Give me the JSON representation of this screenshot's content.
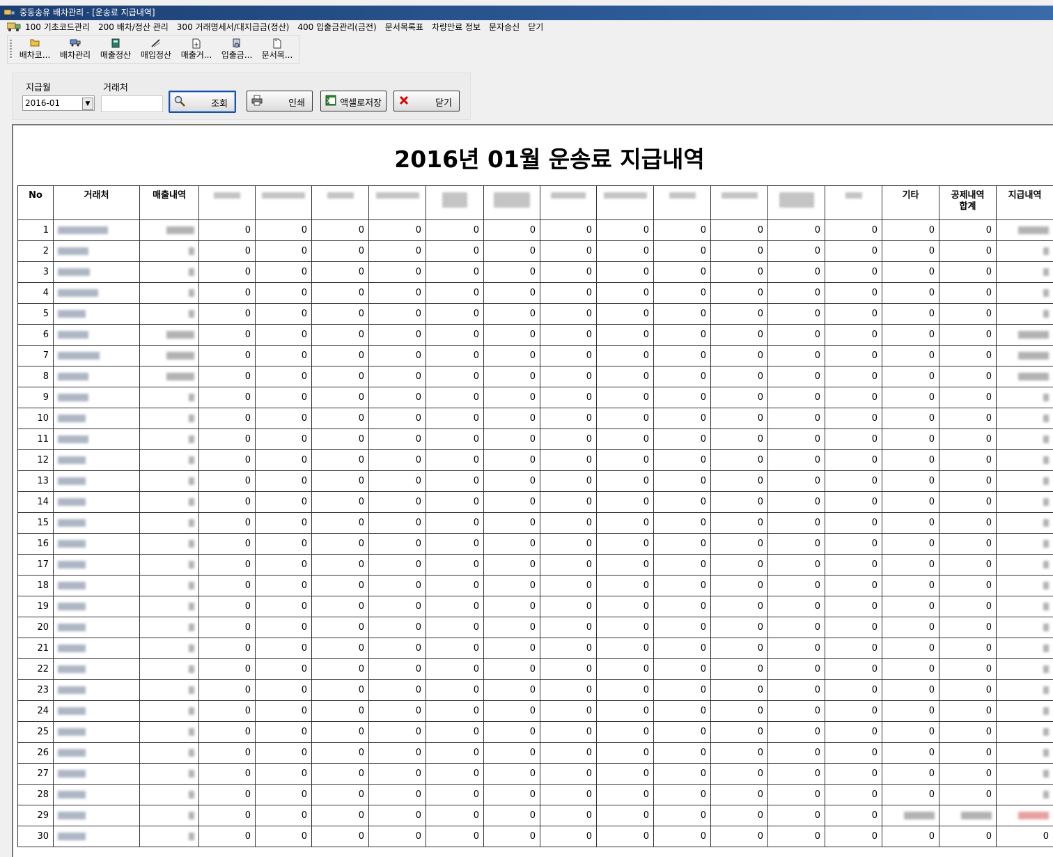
{
  "window": {
    "title": "중동송유 배차관리 - [운송료 지급내역]"
  },
  "menu": [
    "100 기초코드관리",
    "200 배차/정산 관리",
    "300 거래명세서/대지급금(정산)",
    "400 입출금관리(금전)",
    "문서목록표",
    "차량만료 정보",
    "문자송신",
    "닫기"
  ],
  "toolbar": [
    {
      "label": "배차코...",
      "icon": "folder-icon"
    },
    {
      "label": "배차관리",
      "icon": "truck-icon"
    },
    {
      "label": "매출정산",
      "icon": "calculator-icon"
    },
    {
      "label": "매입정산",
      "icon": "pencil-icon"
    },
    {
      "label": "매출거...",
      "icon": "document-add-icon"
    },
    {
      "label": "입출금...",
      "icon": "cash-icon"
    },
    {
      "label": "문서목...",
      "icon": "document-icon"
    }
  ],
  "filter": {
    "month_label": "지급월",
    "month_value": "2016-01",
    "partner_label": "거래처",
    "partner_value": "",
    "search_label": "조회",
    "print_label": "인쇄",
    "excel_label": "액셀로저장",
    "close_label": "닫기"
  },
  "report": {
    "title": "2016년 01월 운송료 지급내역",
    "headers": {
      "no": "No",
      "partner": "거래처",
      "sales": "매출내역",
      "other": "기타",
      "deduction_total": "공제내역\n합계",
      "payment": "지급내역"
    },
    "rows": [
      {
        "no": "1",
        "payment": "blur"
      },
      {
        "no": "2"
      },
      {
        "no": "3"
      },
      {
        "no": "4"
      },
      {
        "no": "5"
      },
      {
        "no": "6",
        "payment": "blur"
      },
      {
        "no": "7",
        "payment": "blur"
      },
      {
        "no": "8",
        "payment": "blur"
      },
      {
        "no": "9"
      },
      {
        "no": "10"
      },
      {
        "no": "11"
      },
      {
        "no": "12"
      },
      {
        "no": "13"
      },
      {
        "no": "14"
      },
      {
        "no": "15"
      },
      {
        "no": "16"
      },
      {
        "no": "17"
      },
      {
        "no": "18"
      },
      {
        "no": "19"
      },
      {
        "no": "20"
      },
      {
        "no": "21"
      },
      {
        "no": "22"
      },
      {
        "no": "23"
      },
      {
        "no": "24"
      },
      {
        "no": "25"
      },
      {
        "no": "26"
      },
      {
        "no": "27"
      },
      {
        "no": "28"
      },
      {
        "no": "29",
        "special": true
      },
      {
        "no": "30",
        "last": true
      }
    ],
    "cell_value": "0"
  }
}
